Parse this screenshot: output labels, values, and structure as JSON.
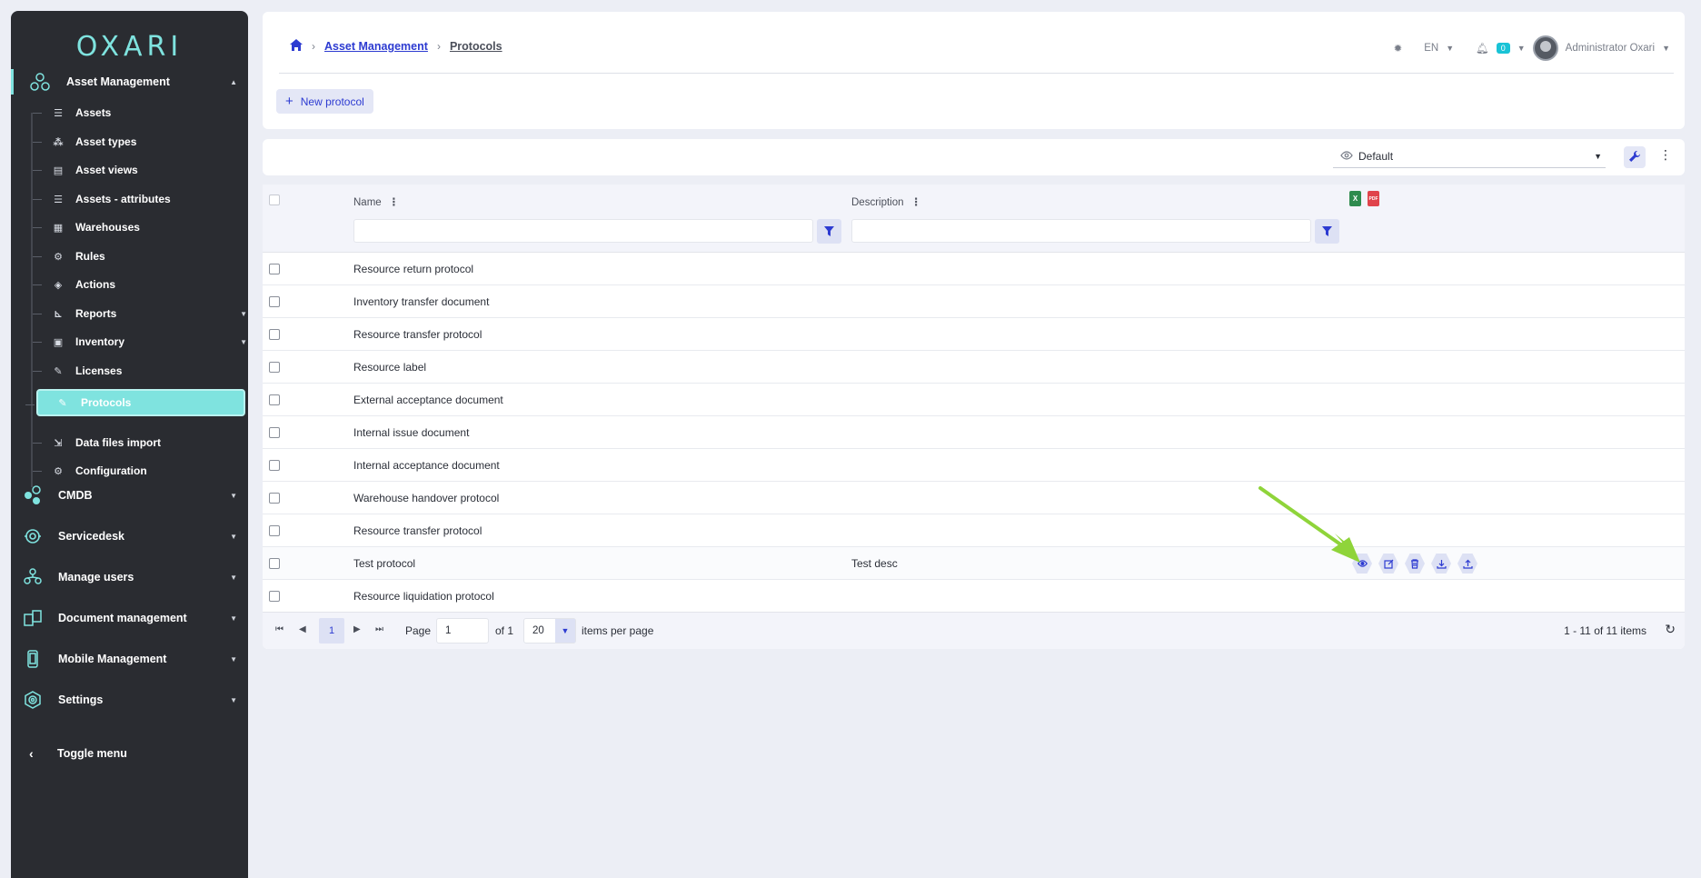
{
  "app": {
    "logo": "OXARI"
  },
  "sidebar": {
    "main": [
      {
        "label": "Asset Management",
        "icon": "asset-management-icon"
      },
      {
        "label": "CMDB",
        "icon": "cmdb-icon"
      },
      {
        "label": "Servicedesk",
        "icon": "servicedesk-icon"
      },
      {
        "label": "Manage users",
        "icon": "manage-users-icon"
      },
      {
        "label": "Document management",
        "icon": "document-management-icon"
      },
      {
        "label": "Mobile Management",
        "icon": "mobile-icon"
      },
      {
        "label": "Settings",
        "icon": "settings-icon"
      }
    ],
    "sub": [
      {
        "label": "Assets"
      },
      {
        "label": "Asset types"
      },
      {
        "label": "Asset views"
      },
      {
        "label": "Assets - attributes"
      },
      {
        "label": "Warehouses"
      },
      {
        "label": "Rules"
      },
      {
        "label": "Actions"
      },
      {
        "label": "Reports"
      },
      {
        "label": "Inventory"
      },
      {
        "label": "Licenses"
      },
      {
        "label": "Protocols"
      },
      {
        "label": "Data files import"
      },
      {
        "label": "Configuration"
      }
    ],
    "toggle": "Toggle menu",
    "accent": "#7fe3df"
  },
  "header": {
    "breadcrumb": [
      "Asset Management",
      "Protocols"
    ],
    "lang": "EN",
    "notifications": "0",
    "user": "Administrator Oxari",
    "new_button": "New protocol"
  },
  "toolbar": {
    "view": "Default"
  },
  "table": {
    "columns": [
      "Name",
      "Description"
    ],
    "rows": [
      {
        "name": "Resource return protocol",
        "desc": ""
      },
      {
        "name": "Inventory transfer document",
        "desc": ""
      },
      {
        "name": "Resource transfer protocol",
        "desc": ""
      },
      {
        "name": "Resource label",
        "desc": ""
      },
      {
        "name": "External acceptance document",
        "desc": ""
      },
      {
        "name": "Internal issue document",
        "desc": ""
      },
      {
        "name": "Internal acceptance document",
        "desc": ""
      },
      {
        "name": "Warehouse handover protocol",
        "desc": ""
      },
      {
        "name": "Resource transfer protocol",
        "desc": ""
      },
      {
        "name": "Test protocol",
        "desc": "Test desc"
      },
      {
        "name": "Resource liquidation protocol",
        "desc": ""
      }
    ],
    "export": {
      "xls": "X",
      "pdf": "PDF"
    }
  },
  "pager": {
    "current": "1",
    "page_label": "Page",
    "page_value": "1",
    "of": "of 1",
    "size": "20",
    "per_page": "items per page",
    "info": "1 - 11 of 11 items"
  }
}
